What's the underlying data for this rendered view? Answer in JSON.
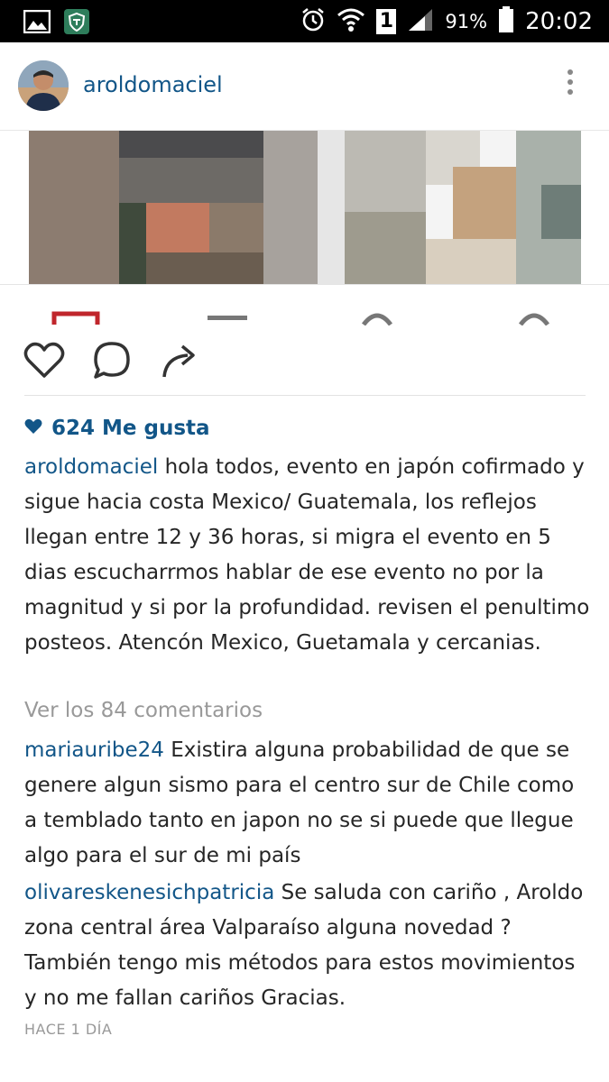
{
  "status_bar": {
    "battery_percent": "91%",
    "time": "20:02",
    "sim_slot": "1",
    "icons": [
      "gallery-icon",
      "shield-app-icon",
      "alarm-icon",
      "wifi-icon",
      "signal-icon",
      "battery-icon"
    ]
  },
  "post": {
    "username": "aroldomaciel",
    "likes": "624 Me gusta",
    "caption_user": "aroldomaciel",
    "caption_text": "hola todos, evento en japón cofirmado y sigue hacia costa Mexico/ Guatemala, los reflejos llegan entre 12 y 36 horas, si migra el evento en 5 dias escucharrmos hablar de ese evento no por la magnitud y si por la profundidad. revisen el penultimo posteos. Atencón Mexico, Guetamala y cercanias.",
    "view_comments": "Ver los 84 comentarios",
    "comments": [
      {
        "user": "mariauribe24",
        "text": "Existira alguna probabilidad de que se genere algun sismo para el centro sur de Chile como a temblado tanto en japon no se si puede que llegue algo para el sur de mi país"
      },
      {
        "user": "olivareskenesichpatricia",
        "text": "Se saluda con cariño , Aroldo zona central área Valparaíso alguna novedad ? También tengo mis métodos para estos movimientos y no me fallan cariños Gracias."
      }
    ],
    "time_ago": "HACE 1 DÍA"
  },
  "colors": {
    "link_blue": "#125688",
    "text": "#262626",
    "muted": "#999999"
  }
}
